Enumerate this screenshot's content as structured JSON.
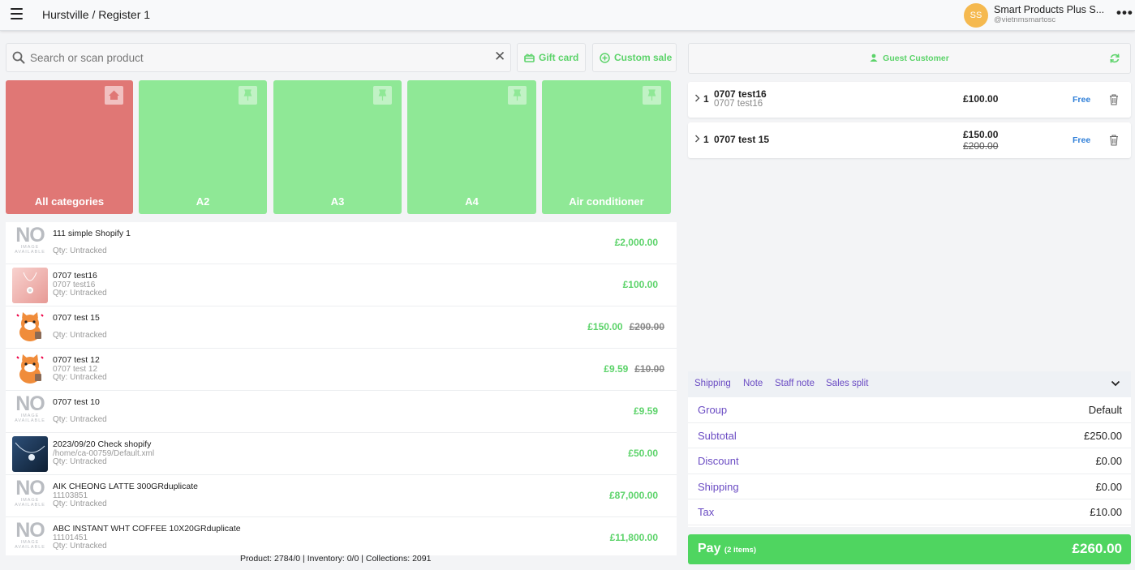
{
  "header": {
    "location": "Hurstville / Register 1",
    "avatar_initials": "SS",
    "store_name": "Smart Products Plus S...",
    "store_handle": "@vietnmsmartosc",
    "more_label": "•••"
  },
  "search": {
    "placeholder": "Search or scan product",
    "clear_label": "✕"
  },
  "toolbar": {
    "gift_card_label": "Gift card",
    "custom_sale_label": "Custom sale"
  },
  "categories": [
    {
      "label": "All categories",
      "icon": "home-icon"
    },
    {
      "label": "A2",
      "icon": "pin-icon"
    },
    {
      "label": "A3",
      "icon": "pin-icon"
    },
    {
      "label": "A4",
      "icon": "pin-icon"
    },
    {
      "label": "Air conditioner",
      "icon": "pin-icon"
    }
  ],
  "no_image": {
    "line1": "NO",
    "line2": "IMAGE",
    "line3": "AVAILABLE"
  },
  "products": [
    {
      "name": "111 simple Shopify 1",
      "sku": "",
      "qty": "Qty: Untracked",
      "price": "£2,000.00",
      "old_price": ""
    },
    {
      "name": "0707 test16",
      "sku": "0707 test16",
      "qty": "Qty: Untracked",
      "price": "£100.00",
      "old_price": ""
    },
    {
      "name": "0707 test 15",
      "sku": "",
      "qty": "Qty: Untracked",
      "price": "£150.00",
      "old_price": "£200.00"
    },
    {
      "name": "0707 test 12",
      "sku": "0707 test 12",
      "qty": "Qty: Untracked",
      "price": "£9.59",
      "old_price": "£10.00"
    },
    {
      "name": "0707 test 10",
      "sku": "",
      "qty": "Qty: Untracked",
      "price": "£9.59",
      "old_price": ""
    },
    {
      "name": "2023/09/20 Check shopify",
      "sku": "/home/ca-00759/Default.xml",
      "qty": "Qty: Untracked",
      "price": "£50.00",
      "old_price": ""
    },
    {
      "name": "AIK CHEONG LATTE 300GRduplicate",
      "sku": "11103851",
      "qty": "Qty: Untracked",
      "price": "£87,000.00",
      "old_price": ""
    },
    {
      "name": "ABC INSTANT WHT COFFEE 10X20GRduplicate",
      "sku": "11101451",
      "qty": "Qty: Untracked",
      "price": "£11,800.00",
      "old_price": ""
    }
  ],
  "footer": {
    "stats": "Product: 2784/0 | Inventory: 0/0 | Collections: 2091"
  },
  "customer": {
    "label": "Guest Customer"
  },
  "cart": [
    {
      "qty": "1",
      "title": "0707 test16",
      "subtitle": "0707 test16",
      "price": "£100.00",
      "old_price": "",
      "badge": "Free"
    },
    {
      "qty": "1",
      "title": "0707 test 15",
      "subtitle": "",
      "price": "£150.00",
      "old_price": "£200.00",
      "badge": "Free"
    }
  ],
  "cart_tabs": {
    "shipping": "Shipping",
    "note": "Note",
    "staff_note": "Staff note",
    "sales_split": "Sales split"
  },
  "totals": [
    {
      "label": "Group",
      "value": "Default"
    },
    {
      "label": "Subtotal",
      "value": "£250.00"
    },
    {
      "label": "Discount",
      "value": "£0.00"
    },
    {
      "label": "Shipping",
      "value": "£0.00"
    },
    {
      "label": "Tax",
      "value": "£10.00"
    }
  ],
  "pay": {
    "label": "Pay",
    "count": "(2 items)",
    "total": "£260.00"
  },
  "colors": {
    "accent_green": "#5cd36a",
    "tile_green": "#8fe896",
    "tile_red": "#e07775",
    "label_purple": "#6a4bc3",
    "link_blue": "#2f7fd8"
  }
}
